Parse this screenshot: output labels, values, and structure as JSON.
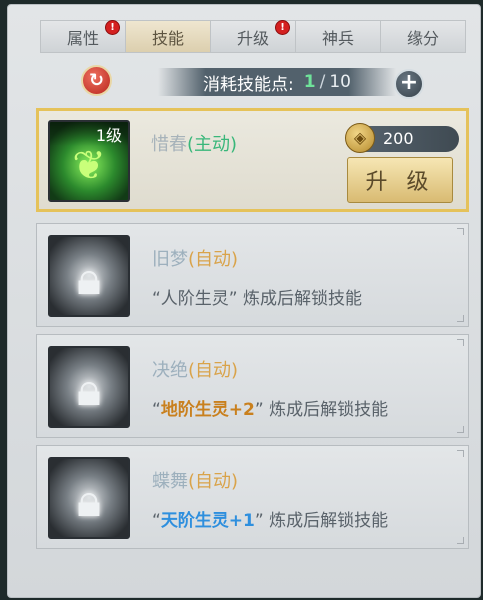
{
  "tabs": [
    {
      "label": "属性",
      "alert": "!"
    },
    {
      "label": "技能",
      "alert": ""
    },
    {
      "label": "升级",
      "alert": "!"
    },
    {
      "label": "神兵",
      "alert": ""
    },
    {
      "label": "缘分",
      "alert": ""
    }
  ],
  "active_tab": "技能",
  "points": {
    "label": "消耗技能点:",
    "current": "1",
    "separator": "/",
    "max": "10"
  },
  "skills": [
    {
      "name": "惜春",
      "type": "(主动)",
      "level": "1级",
      "cost": "200",
      "upgrade_label": "升 级"
    },
    {
      "name": "旧梦",
      "type": "(自动)",
      "unlock_pre": "“人阶生灵”",
      "unlock_highlight": "",
      "unlock_post": " 炼成后解锁技能"
    },
    {
      "name": "决绝",
      "type": "(自动)",
      "unlock_pre": "“",
      "unlock_highlight": "地阶生灵+2",
      "unlock_post": "” 炼成后解锁技能"
    },
    {
      "name": "蝶舞",
      "type": "(自动)",
      "unlock_pre": "“",
      "unlock_highlight": "天阶生灵+1",
      "unlock_post": "” 炼成后解锁技能"
    }
  ],
  "icons": {
    "refresh": "refresh-icon",
    "plus": "plus-icon",
    "coin": "coin-icon",
    "lock": "lock-icon",
    "leaf": "leaf-skill-icon"
  },
  "colors": {
    "active_type": "#39b77a",
    "auto_type": "#d9a34a",
    "points_current": "#6fe39a",
    "selected_border": "#e5c25a",
    "alert_dot": "#d42020"
  }
}
